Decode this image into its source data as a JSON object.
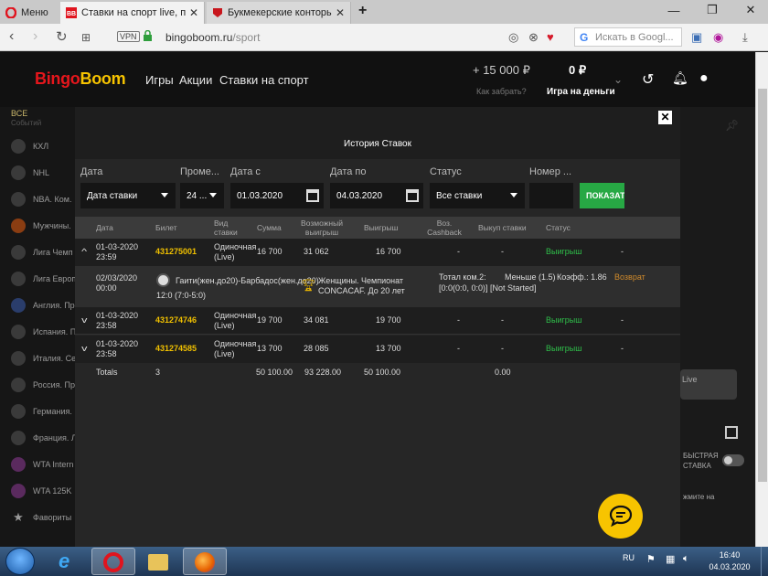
{
  "browser": {
    "tabs": [
      {
        "label": "Меню"
      },
      {
        "label": "Ставки на спорт live, прем"
      },
      {
        "label": "Букмекерские конторы Ро"
      }
    ],
    "url_domain": "bingoboom.ru",
    "url_path": "/sport",
    "vpn_label": "VPN",
    "search_placeholder": "Искать в Googl..."
  },
  "site": {
    "logo_part1": "Bingo",
    "logo_part2": "Boom",
    "nav": [
      "Игры",
      "Акции",
      "Ставки на спорт"
    ],
    "bonus_amount": "+ 15 000 ₽",
    "bonus_link": "Как забрать?",
    "balance": "0 ₽",
    "balance_label": "Игра на деньги"
  },
  "sidebar": {
    "all_label": "ВСЕ",
    "events_label": "Событий",
    "items": [
      {
        "label": "КХЛ"
      },
      {
        "label": "NHL"
      },
      {
        "label": "NBA. Ком."
      },
      {
        "label": "Мужчины."
      },
      {
        "label": "Лига Чемп"
      },
      {
        "label": "Лига Европ"
      },
      {
        "label": "Англия. Пр"
      },
      {
        "label": "Испания. П"
      },
      {
        "label": "Италия. Се"
      },
      {
        "label": "Россия. Пр"
      },
      {
        "label": "Германия."
      },
      {
        "label": "Франция. Л"
      },
      {
        "label": "WTA Intern"
      },
      {
        "label": "WTA 125K"
      },
      {
        "label": "Фавориты"
      }
    ]
  },
  "right_panel": {
    "live_label": "Live",
    "quick_bet": "БЫСТРАЯ\nСТАВКА",
    "hint": "жмите на"
  },
  "modal": {
    "title": "История Ставок",
    "filters": {
      "data_label": "Дата",
      "data_value": "Дата ставки",
      "period_label": "Проме...",
      "period_value": "24 ...",
      "from_label": "Дата с",
      "from_value": "01.03.2020",
      "to_label": "Дата по",
      "to_value": "04.03.2020",
      "status_label": "Статус",
      "status_value": "Все ставки",
      "number_label": "Номер ...",
      "number_value": "",
      "show_button": "ПОКАЗАТЬ"
    },
    "columns": {
      "date": "Дата",
      "ticket": "Билет",
      "bet_type": "Вид ставки",
      "sum": "Сумма",
      "possible_win": "Возможный выигрыш",
      "win": "Выигрыш",
      "cashback": "Воз. Cashback",
      "buyout": "Выкуп ставки",
      "status": "Статус"
    },
    "rows": [
      {
        "date": "01-03-2020",
        "time": "23:59",
        "ticket": "431275001",
        "type1": "Одиночная",
        "type2": "(Live)",
        "sum": "16 700",
        "possible": "31 062",
        "win": "16 700",
        "cashback": "-",
        "buyout": "-",
        "status": "Выигрыш",
        "extra": "-"
      },
      {
        "date": "01-03-2020",
        "time": "23:58",
        "ticket": "431274746",
        "type1": "Одиночная",
        "type2": "(Live)",
        "sum": "19 700",
        "possible": "34 081",
        "win": "19 700",
        "cashback": "-",
        "buyout": "-",
        "status": "Выигрыш",
        "extra": "-"
      },
      {
        "date": "01-03-2020",
        "time": "23:58",
        "ticket": "431274585",
        "type1": "Одиночная",
        "type2": "(Live)",
        "sum": "13 700",
        "possible": "28 085",
        "win": "13 700",
        "cashback": "-",
        "buyout": "-",
        "status": "Выигрыш",
        "extra": "-"
      }
    ],
    "detail": {
      "date": "02/03/2020",
      "time": "00:00",
      "match": "Гаити(жен.до20)-Барбадос(жен.до20)",
      "score": "12:0 (7:0-5:0)",
      "tournament1": "Женщины. Чемпионат",
      "tournament2": "CONCACAF. До 20 лет",
      "market1": "Тотал ком.2:",
      "market2": "[0:0(0:0, 0:0)] [Not Started]",
      "outcome": "Меньше (1.5)",
      "coef": "Коэфф.: 1.86",
      "result": "Возврат"
    },
    "totals": {
      "label": "Totals",
      "count": "3",
      "sum": "50 100.00",
      "possible": "93 228.00",
      "win": "50 100.00",
      "buyout": "0.00"
    }
  },
  "taskbar": {
    "lang": "RU",
    "time": "16:40",
    "date": "04.03.2020"
  }
}
